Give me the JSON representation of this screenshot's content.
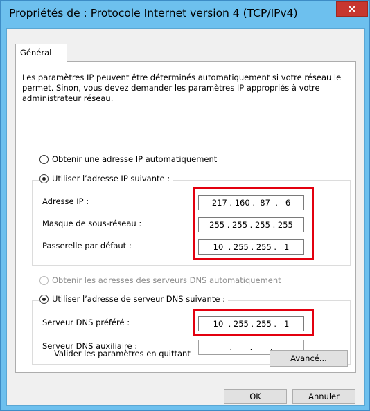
{
  "window": {
    "title": "Propriétés de : Protocole Internet version 4 (TCP/IPv4)",
    "close_icon": "close-icon"
  },
  "tabs": [
    {
      "label": "Général"
    }
  ],
  "description": "Les paramètres IP peuvent être déterminés automatiquement si votre réseau le permet. Sinon, vous devez demander les paramètres IP appropriés à votre administrateur réseau.",
  "ip_mode": {
    "auto_label": "Obtenir une adresse IP automatiquement",
    "manual_label": "Utiliser l’adresse IP suivante :",
    "selected": "manual"
  },
  "ip_fields": {
    "address_label": "Adresse IP :",
    "address_value": "217 . 160 .  87  .   6",
    "mask_label": "Masque de sous-réseau :",
    "mask_value": "255 . 255 . 255 . 255",
    "gateway_label": "Passerelle par défaut :",
    "gateway_value": "10  . 255 . 255 .   1"
  },
  "dns_mode": {
    "auto_label": "Obtenir les adresses des serveurs DNS automatiquement",
    "manual_label": "Utiliser l’adresse de serveur DNS suivante :",
    "selected": "manual"
  },
  "dns_fields": {
    "preferred_label": "Serveur DNS préféré :",
    "preferred_value": "10  . 255 . 255 .   1",
    "alternate_label": "Serveur DNS auxiliaire :",
    "alternate_value": ".       .       ."
  },
  "validate_checkbox": {
    "label": "Valider les paramètres en quittant",
    "checked": false
  },
  "buttons": {
    "advanced": "Avancé...",
    "ok": "OK",
    "cancel": "Annuler"
  },
  "colors": {
    "title_bar": "#6dc0ee",
    "highlight": "#e3000f",
    "close_button": "#c7372f"
  }
}
